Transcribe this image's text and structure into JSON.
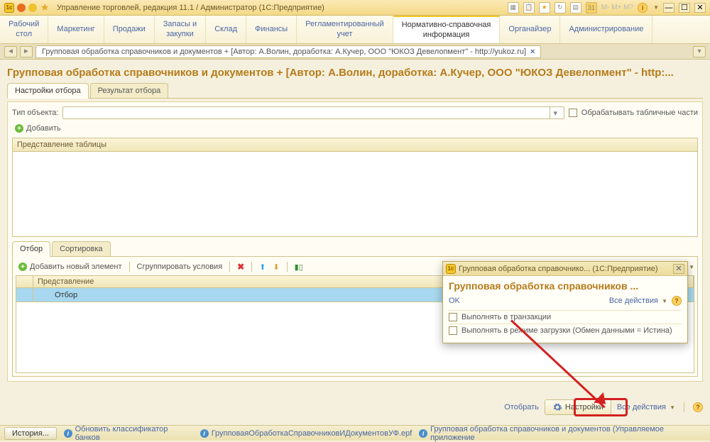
{
  "titlebar": {
    "app_title": "Управление торговлей, редакция 11.1 / Администратор   (1С:Предприятие)"
  },
  "main_tabs": [
    "Рабочий\nстол",
    "Маркетинг",
    "Продажи",
    "Запасы и\nзакупки",
    "Склад",
    "Финансы",
    "Регламентированный\nучет",
    "Нормативно-справочная\nинформация",
    "Органайзер",
    "Администрирование"
  ],
  "breadcrumb": {
    "text": "Групповая обработка справочников и документов + [Автор: А.Волин, доработка: А.Кучер, ООО \"ЮКОЗ Девелопмент\" - http://yukoz.ru]"
  },
  "page_title": "Групповая обработка справочников и документов + [Автор: А.Волин, доработка: А.Кучер, ООО \"ЮКОЗ Девелопмент\" - http:...",
  "inner_tabs": {
    "tab1": "Настройки отбора",
    "tab2": "Результат отбора"
  },
  "type_row": {
    "label": "Тип объекта:",
    "checkbox_label": "Обрабатывать табличные части"
  },
  "toolbar": {
    "add": "Добавить"
  },
  "table": {
    "header": "Представление таблицы"
  },
  "sub_tabs": {
    "tab1": "Отбор",
    "tab2": "Сортировка"
  },
  "sub_toolbar": {
    "add_new": "Добавить новый элемент",
    "group": "Сгруппировать условия"
  },
  "filter_table": {
    "header": "Представление",
    "row1": "Отбор"
  },
  "footer": {
    "select": "Отобрать",
    "settings": "Настройки",
    "all_actions": "Все действия"
  },
  "status": {
    "history": "История...",
    "item1": "Обновить классификатор банков",
    "item2": "ГрупповаяОбработкаСправочниковИДокументовУФ.epf",
    "item3": "Групповая обработка справочников и документов (Управляемое приложение"
  },
  "popup": {
    "title": "Групповая обработка справочнико...   (1С:Предприятие)",
    "heading": "Групповая обработка справочников ...",
    "ok": "OK",
    "all_actions": "Все действия",
    "check1": "Выполнять в транзакции",
    "check2": "Выполнять в режиме загрузки (Обмен данными = Истина)"
  }
}
